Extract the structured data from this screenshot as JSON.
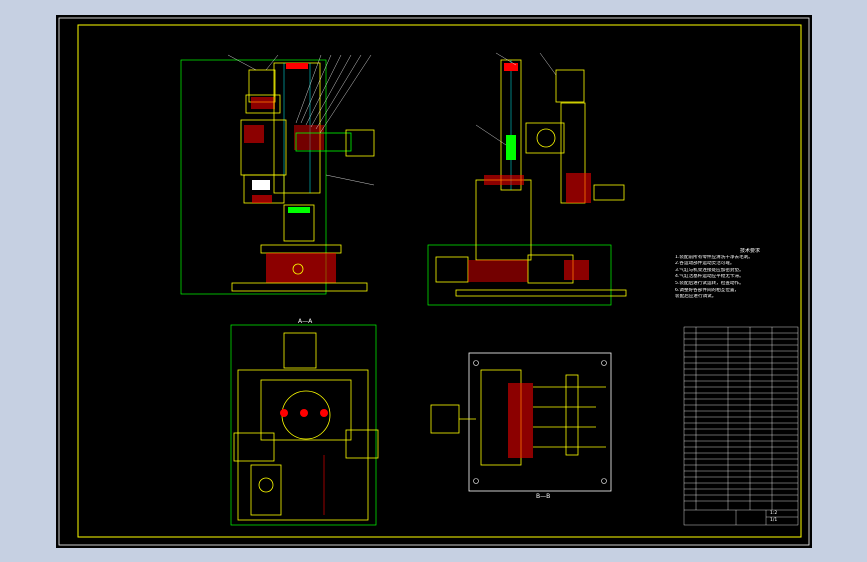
{
  "title": "",
  "colors": {
    "background": "#c6d0e2",
    "sheet": "#000000",
    "border": "#ffff00",
    "part_green": "#00ff00",
    "part_yellow": "#ffff00",
    "hatch_red": "#ff0000",
    "text": "#ffffff",
    "accent_cyan": "#00ffff"
  },
  "views": [
    {
      "id": "front-section",
      "label": ""
    },
    {
      "id": "side-view",
      "label": ""
    },
    {
      "id": "plan-view-a",
      "label": "A—A"
    },
    {
      "id": "plan-view-b",
      "label": "B—B"
    }
  ],
  "notes": {
    "title": "技术要求",
    "items": [
      "1.装配前所有零件应清洗干净去毛刺。",
      "2.各运动部件运动灵活可靠。",
      "3.气缸与机架连接处应加密封垫。",
      "4.气缸活塞杆运动应平稳无卡滞。",
      "5.装配后进行试运转，检查动作。",
      "6.调整好各部件间的相互位置，",
      "  装配后应进行调试。"
    ]
  },
  "title_block": {
    "scale": "1:2",
    "sheet": "1/1"
  }
}
